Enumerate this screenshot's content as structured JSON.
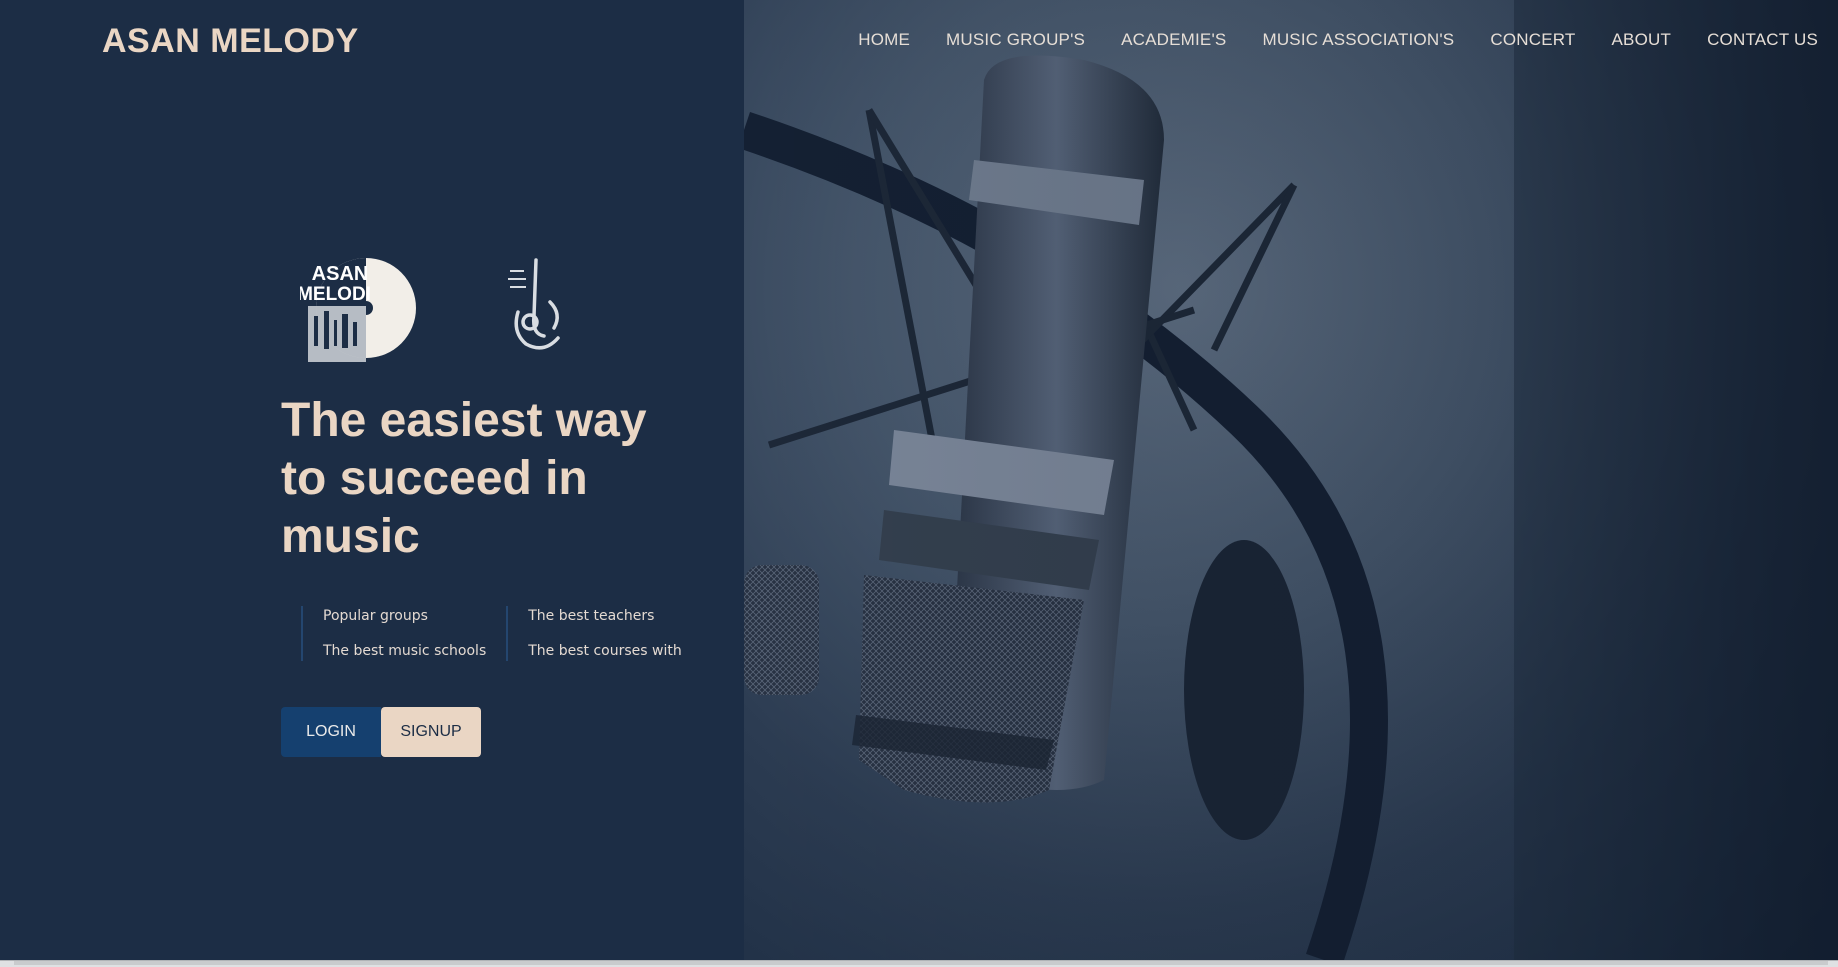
{
  "brand": {
    "title": "ASAN MELODY"
  },
  "nav": {
    "items": [
      "HOME",
      "MUSIC GROUP'S",
      "ACADEMIE'S",
      "MUSIC ASSOCIATION'S",
      "CONCERT",
      "ABOUT",
      "CONTACT US"
    ]
  },
  "logos": {
    "disc_text_line1": "ASAN",
    "disc_text_line2": "MELODI"
  },
  "hero": {
    "headline": "The easiest way to succeed in music"
  },
  "features": {
    "col1": [
      "Popular groups",
      "The best music schools"
    ],
    "col2": [
      "The best teachers",
      "The best courses with"
    ]
  },
  "buttons": {
    "login": "LOGIN",
    "signup": "SIGNUP"
  },
  "colors": {
    "panel": "#1c2d45",
    "accent": "#ead6c4",
    "button_primary": "#15406f"
  }
}
